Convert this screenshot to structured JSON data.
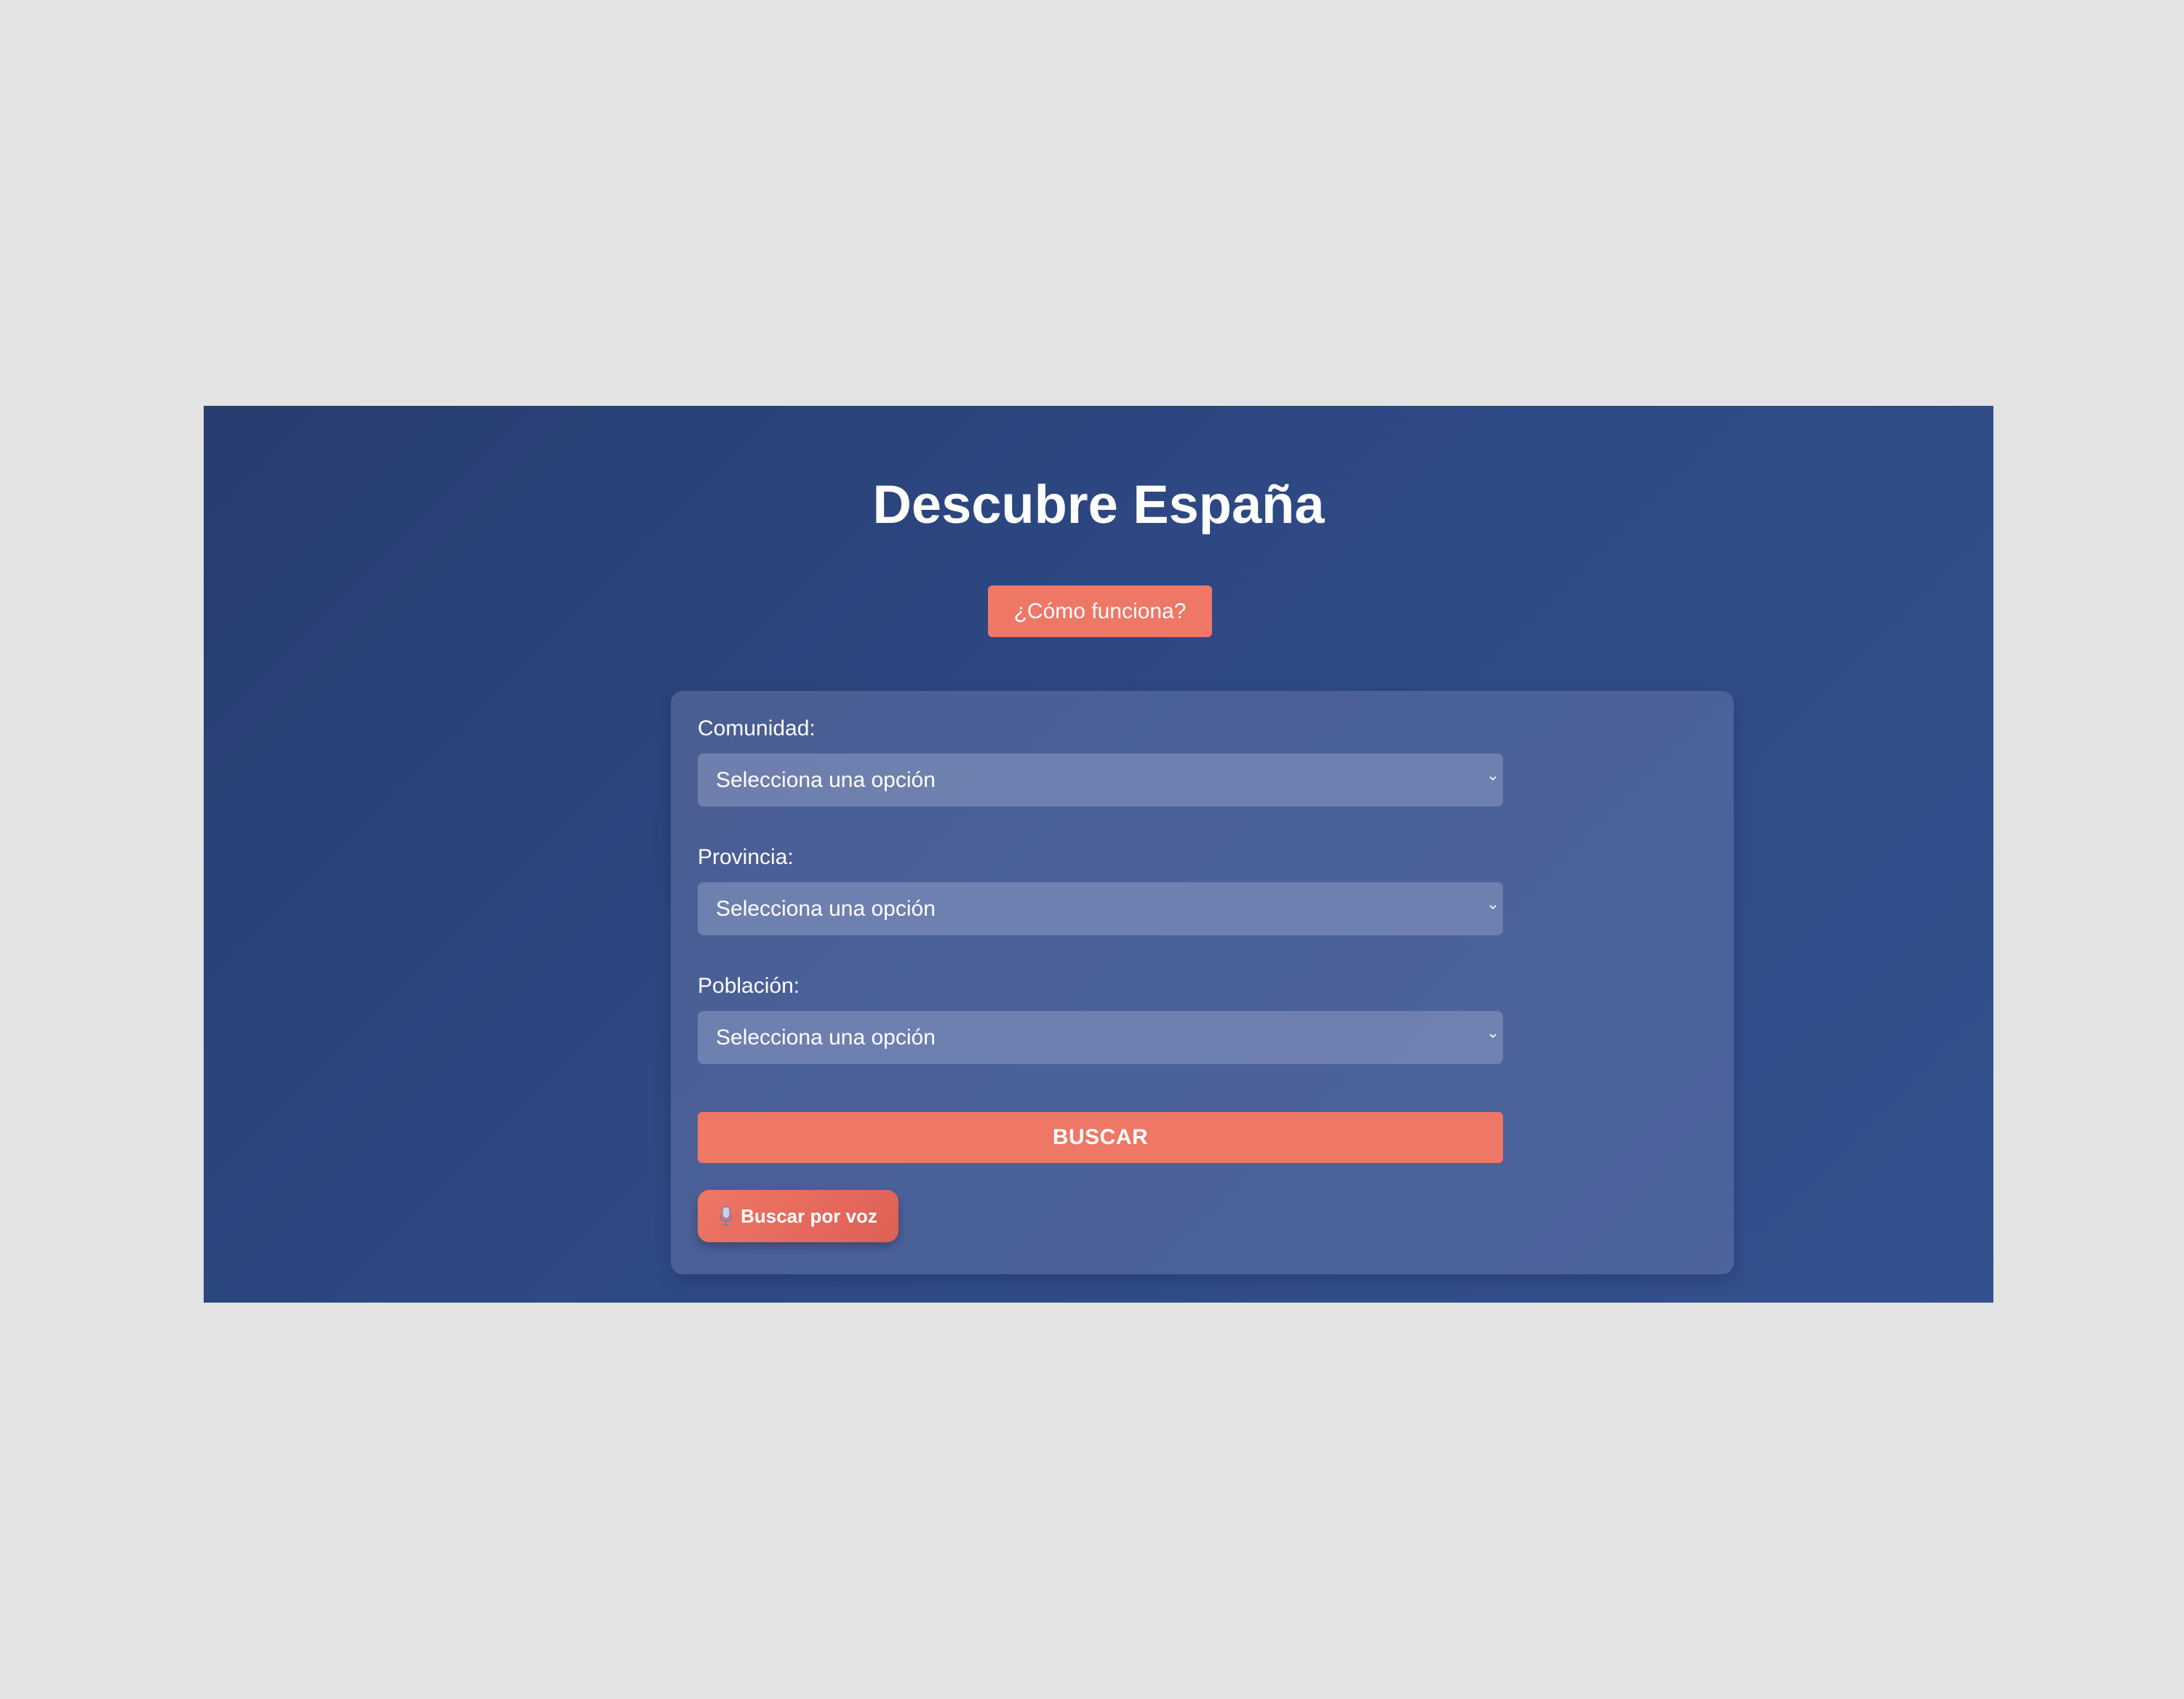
{
  "header": {
    "title": "Descubre España",
    "help_button_label": "¿Cómo funciona?"
  },
  "form": {
    "fields": [
      {
        "label": "Comunidad:",
        "selected": "Selecciona una opción"
      },
      {
        "label": "Provincia:",
        "selected": "Selecciona una opción"
      },
      {
        "label": "Población:",
        "selected": "Selecciona una opción"
      }
    ],
    "search_button_label": "BUSCAR",
    "voice_button_label": "Buscar por voz"
  },
  "icons": {
    "voice": "microphone-icon",
    "select_arrow": "chevron-down-icon"
  },
  "colors": {
    "page_background": "#e3e3e3",
    "hero_background": "#2e4a86",
    "accent": "#ee7766",
    "text": "#ffffff"
  }
}
